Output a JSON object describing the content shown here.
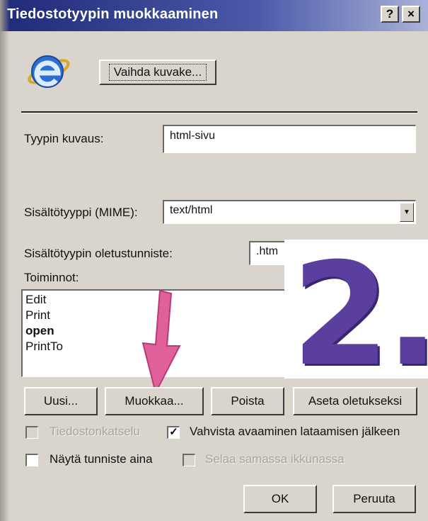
{
  "window": {
    "title": "Tiedostotyypin muokkaaminen",
    "help_button": "?",
    "close_button": "×"
  },
  "icon": {
    "name": "internet-explorer-icon"
  },
  "change_icon_button": "Vaihda kuvake...",
  "type_description": {
    "label": "Tyypin kuvaus:",
    "value": "html-sivu"
  },
  "mime": {
    "label": "Sisältötyyppi (MIME):",
    "value": "text/html"
  },
  "default_extension": {
    "label": "Sisältötyypin oletustunniste:",
    "value": ".htm"
  },
  "actions": {
    "label": "Toiminnot:",
    "items": [
      "Edit",
      "Print",
      "open",
      "PrintTo"
    ],
    "default_item": "open"
  },
  "buttons": {
    "new": "Uusi...",
    "edit": "Muokkaa...",
    "remove": "Poista",
    "set_default": "Aseta oletukseksi",
    "ok": "OK",
    "cancel": "Peruuta"
  },
  "checkboxes": {
    "file_security": {
      "label": "Tiedostonkatselu",
      "checked": false,
      "enabled": false
    },
    "confirm_open": {
      "label": "Vahvista avaaminen lataamisen jälkeen",
      "checked": true,
      "enabled": true
    },
    "always_show_ext": {
      "label": "Näytä tunniste aina",
      "checked": false,
      "enabled": true
    },
    "browse_same_window": {
      "label": "Selaa samassa ikkunassa",
      "checked": false,
      "enabled": false
    }
  },
  "annotation": {
    "step_label": "2.",
    "color": "#5b3f9e",
    "arrow_color": "#e0609a"
  }
}
